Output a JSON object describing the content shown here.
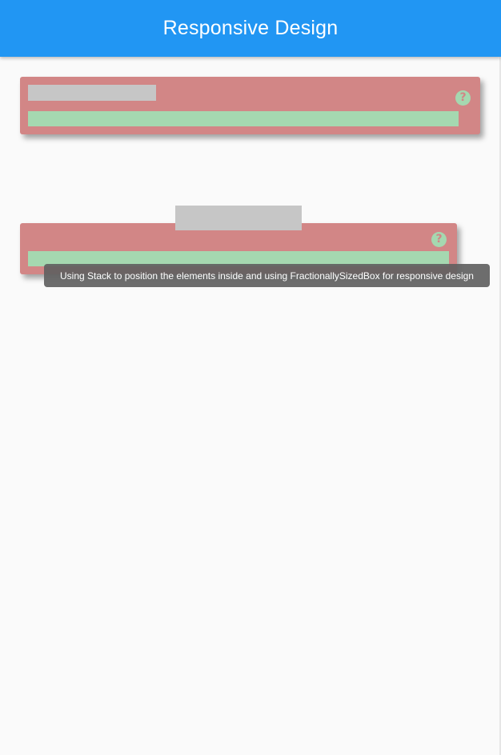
{
  "app_bar": {
    "title": "Responsive Design",
    "color": "#2196f3"
  },
  "cards": [
    {
      "help_icon": {
        "glyph": "?",
        "name": "help-icon"
      }
    },
    {
      "help_icon": {
        "glyph": "?",
        "name": "help-icon"
      }
    }
  ],
  "tooltip": {
    "text": "Using Stack to position the elements inside and using FractionallySizedBox for responsive design"
  },
  "colors": {
    "background": "#fafafa",
    "card": "#d28686",
    "grey_bar": "#c6c6c6",
    "green_bar": "#a5d8b0",
    "tooltip": "#616161"
  }
}
